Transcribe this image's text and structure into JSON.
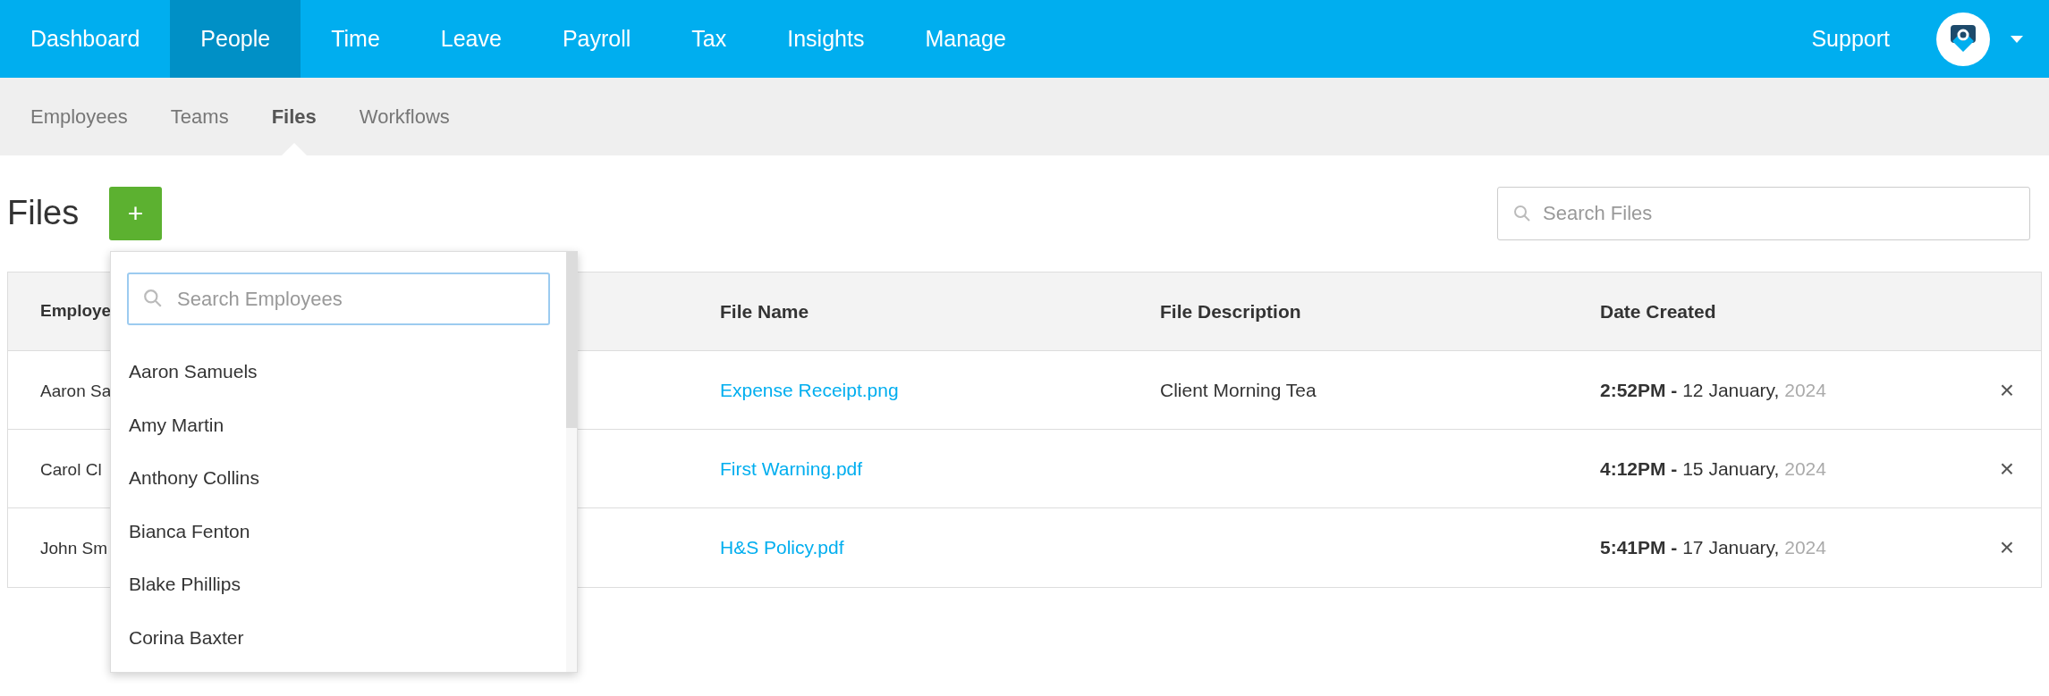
{
  "nav": {
    "items": [
      {
        "label": "Dashboard",
        "selected": false
      },
      {
        "label": "People",
        "selected": true
      },
      {
        "label": "Time",
        "selected": false
      },
      {
        "label": "Leave",
        "selected": false
      },
      {
        "label": "Payroll",
        "selected": false
      },
      {
        "label": "Tax",
        "selected": false
      },
      {
        "label": "Insights",
        "selected": false
      },
      {
        "label": "Manage",
        "selected": false
      }
    ],
    "support": "Support"
  },
  "subnav": {
    "items": [
      {
        "label": "Employees",
        "selected": false
      },
      {
        "label": "Teams",
        "selected": false
      },
      {
        "label": "Files",
        "selected": true
      },
      {
        "label": "Workflows",
        "selected": false
      }
    ]
  },
  "page": {
    "title": "Files",
    "add_button": "+",
    "search": {
      "placeholder": "Search Files"
    }
  },
  "table": {
    "columns": [
      "Employe",
      "File Name",
      "File Description",
      "Date Created"
    ],
    "rows": [
      {
        "employee": "Aaron Sa",
        "file_name": "Expense Receipt.png",
        "description": "Client Morning Tea",
        "time": "2:52PM -",
        "date": "12 January,",
        "year": "2024",
        "delete": "×"
      },
      {
        "employee": "Carol Cl",
        "file_name": "First Warning.pdf",
        "time": "4:12PM -",
        "date": "15 January,",
        "year": "2024",
        "delete": "×"
      },
      {
        "employee": "John Sm",
        "file_name": "H&S Policy.pdf",
        "time": "5:41PM -",
        "date": "17 January,",
        "year": "2024",
        "delete": "×"
      }
    ]
  },
  "employee_dropdown": {
    "search": {
      "placeholder": "Search Employees"
    },
    "items": [
      "Aaron Samuels",
      "Amy Martin",
      "Anthony Collins",
      "Bianca Fenton",
      "Blake Phillips",
      "Corina Baxter"
    ]
  }
}
